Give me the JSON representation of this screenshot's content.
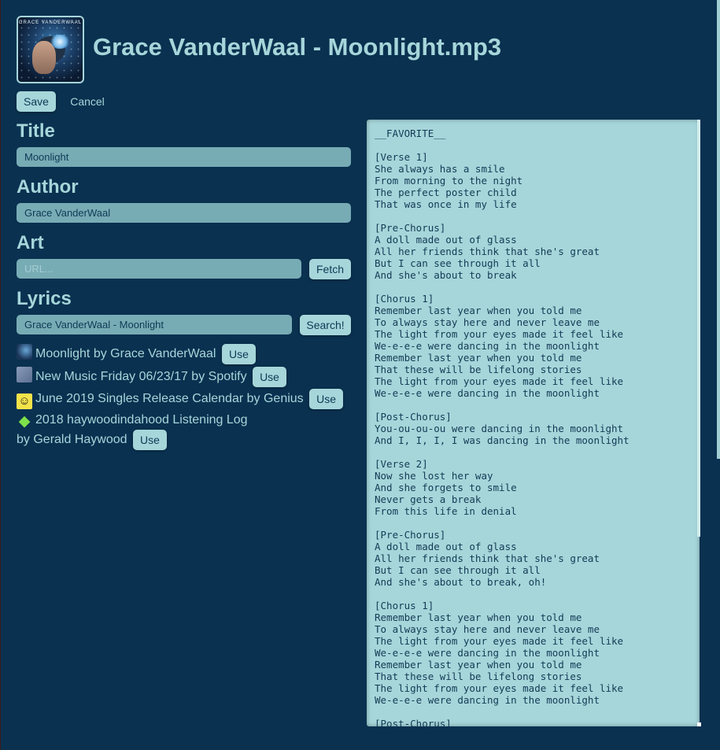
{
  "header": {
    "cover_caption": "GRACE VANDERWAAL",
    "title": "Grace VanderWaal - Moonlight.mp3"
  },
  "toolbar": {
    "save_label": "Save",
    "cancel_label": "Cancel"
  },
  "form": {
    "title_heading": "Title",
    "title_value": "Moonlight",
    "author_heading": "Author",
    "author_value": "Grace VanderWaal",
    "art_heading": "Art",
    "art_placeholder": "URL...",
    "fetch_label": "Fetch",
    "lyrics_heading": "Lyrics",
    "lyrics_search_value": "Grace VanderWaal - Moonlight",
    "search_label": "Search!"
  },
  "results": [
    {
      "text": "Moonlight by Grace VanderWaal",
      "icon": "album-art-icon",
      "use_label": "Use"
    },
    {
      "text": "New Music Friday 06/23/17 by Spotify",
      "icon": "playlist-icon",
      "use_label": "Use"
    },
    {
      "text": "June 2019 Singles Release Calendar by Genius",
      "icon": "genius-smiley-icon",
      "use_label": "Use"
    },
    {
      "text": "2018 haywoodindahood Listening Log",
      "text2": "by Gerald Haywood",
      "icon": "green-gem-icon",
      "use_label": "Use"
    }
  ],
  "lyrics_text": "__FAVORITE__\n\n[Verse 1]\nShe always has a smile\nFrom morning to the night\nThe perfect poster child\nThat was once in my life\n\n[Pre-Chorus]\nA doll made out of glass\nAll her friends think that she's great\nBut I can see through it all\nAnd she's about to break\n\n[Chorus 1]\nRemember last year when you told me\nTo always stay here and never leave me\nThe light from your eyes made it feel like\nWe-e-e-e were dancing in the moonlight\nRemember last year when you told me\nThat these will be lifelong stories\nThe light from your eyes made it feel like\nWe-e-e-e were dancing in the moonlight\n\n[Post-Chorus]\nYou-ou-ou-ou were dancing in the moonlight\nAnd I, I, I, I was dancing in the moonlight\n\n[Verse 2]\nNow she lost her way\nAnd she forgets to smile\nNever gets a break\nFrom this life in denial\n\n[Pre-Chorus]\nA doll made out of glass\nAll her friends think that she's great\nBut I can see through it all\nAnd she's about to break, oh!\n\n[Chorus 1]\nRemember last year when you told me\nTo always stay here and never leave me\nThe light from your eyes made it feel like\nWe-e-e-e were dancing in the moonlight\nRemember last year when you told me\nThat these will be lifelong stories\nThe light from your eyes made it feel like\nWe-e-e-e were dancing in the moonlight\n\n[Post-Chorus]",
  "colors": {
    "background": "#0a3150",
    "accent": "#a6d6da",
    "field": "#78acb5"
  }
}
